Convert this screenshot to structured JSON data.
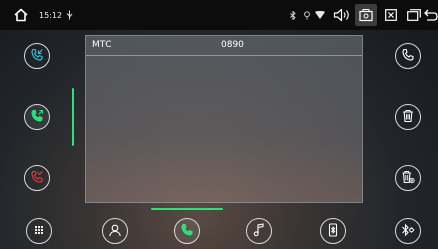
{
  "status_bar": {
    "time": "15:12",
    "icons": [
      "home-icon",
      "usb-icon",
      "bluetooth-icon",
      "location-icon",
      "wifi-icon",
      "volume-icon",
      "screenshot-icon",
      "close-window-icon",
      "recent-apps-icon",
      "back-icon"
    ]
  },
  "left_sidebar": {
    "buttons": [
      {
        "icon": "incoming-call-icon",
        "color": "#2cc4e8",
        "state": "normal"
      },
      {
        "icon": "outgoing-call-icon",
        "color": "#2ee07b",
        "state": "selected"
      },
      {
        "icon": "missed-call-icon",
        "color": "#e63b3b",
        "state": "normal"
      }
    ]
  },
  "call_log": {
    "rows": [
      {
        "name": "МТС",
        "number": "0890"
      }
    ]
  },
  "right_sidebar": {
    "buttons": [
      "call-icon",
      "delete-icon",
      "delete-all-icon"
    ]
  },
  "bottom_bar": {
    "buttons": [
      "dialpad-icon",
      "contacts-icon",
      "call-log-icon",
      "music-icon",
      "bluetooth-device-icon",
      "bluetooth-settings-icon"
    ],
    "active": "call-log-icon"
  },
  "colors": {
    "accent_green": "#2ee07b",
    "accent_cyan": "#2cc4e8",
    "accent_red": "#e63b3b",
    "statusbar_bg": "#0c0c0c"
  }
}
